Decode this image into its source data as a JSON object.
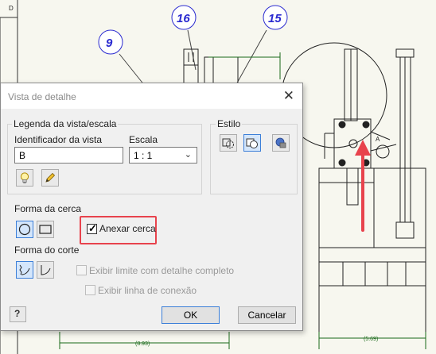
{
  "drawing": {
    "balloons": [
      "9",
      "16",
      "15"
    ],
    "view_letter": "D",
    "detail_marker": "A",
    "dimensions": [
      "(8.93)",
      "(5.69)"
    ]
  },
  "dialog": {
    "title": "Vista de detalhe",
    "close_glyph": "✕",
    "legend_group": {
      "title": "Legenda da vista/escala",
      "identifier_label": "Identificador da vista",
      "identifier_value": "B",
      "scale_label": "Escala",
      "scale_value": "1 : 1",
      "scale_chevron": "⌄"
    },
    "style_group": {
      "title": "Estilo"
    },
    "fence_shape": {
      "title": "Forma da cerca",
      "attach_fence_label": "Anexar cerca",
      "attach_fence_checked": true
    },
    "cut_shape": {
      "title": "Forma do corte",
      "show_boundary_label": "Exibir limite com detalhe completo",
      "show_connection_label": "Exibir linha de conexão"
    },
    "help_glyph": "?",
    "ok_label": "OK",
    "cancel_label": "Cancelar"
  },
  "colors": {
    "highlight": "#e8434d",
    "arrow": "#e8434d",
    "balloon": "#2a2ad0",
    "dimension": "#1a6a1a"
  }
}
